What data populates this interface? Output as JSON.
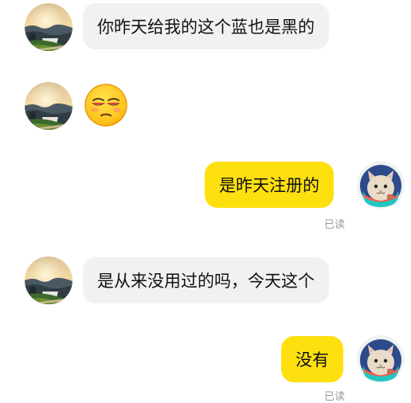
{
  "messages": [
    {
      "text": "你昨天给我的这个蓝也是黑的"
    },
    {
      "emoji": "unamused-face-emoji"
    },
    {
      "text": "是昨天注册的",
      "status": "已读"
    },
    {
      "text": "是从来没用过的吗，今天这个"
    },
    {
      "text": "没有",
      "status": "已读"
    }
  ],
  "colors": {
    "incoming_bubble": "#f1f1f3",
    "outgoing_bubble": "#ffe00f",
    "read_status": "#9a9a9a"
  },
  "icons": {
    "contact_avatar": "landscape-sunset-avatar-icon",
    "own_avatar": "cartoon-cat-avatar-icon"
  }
}
